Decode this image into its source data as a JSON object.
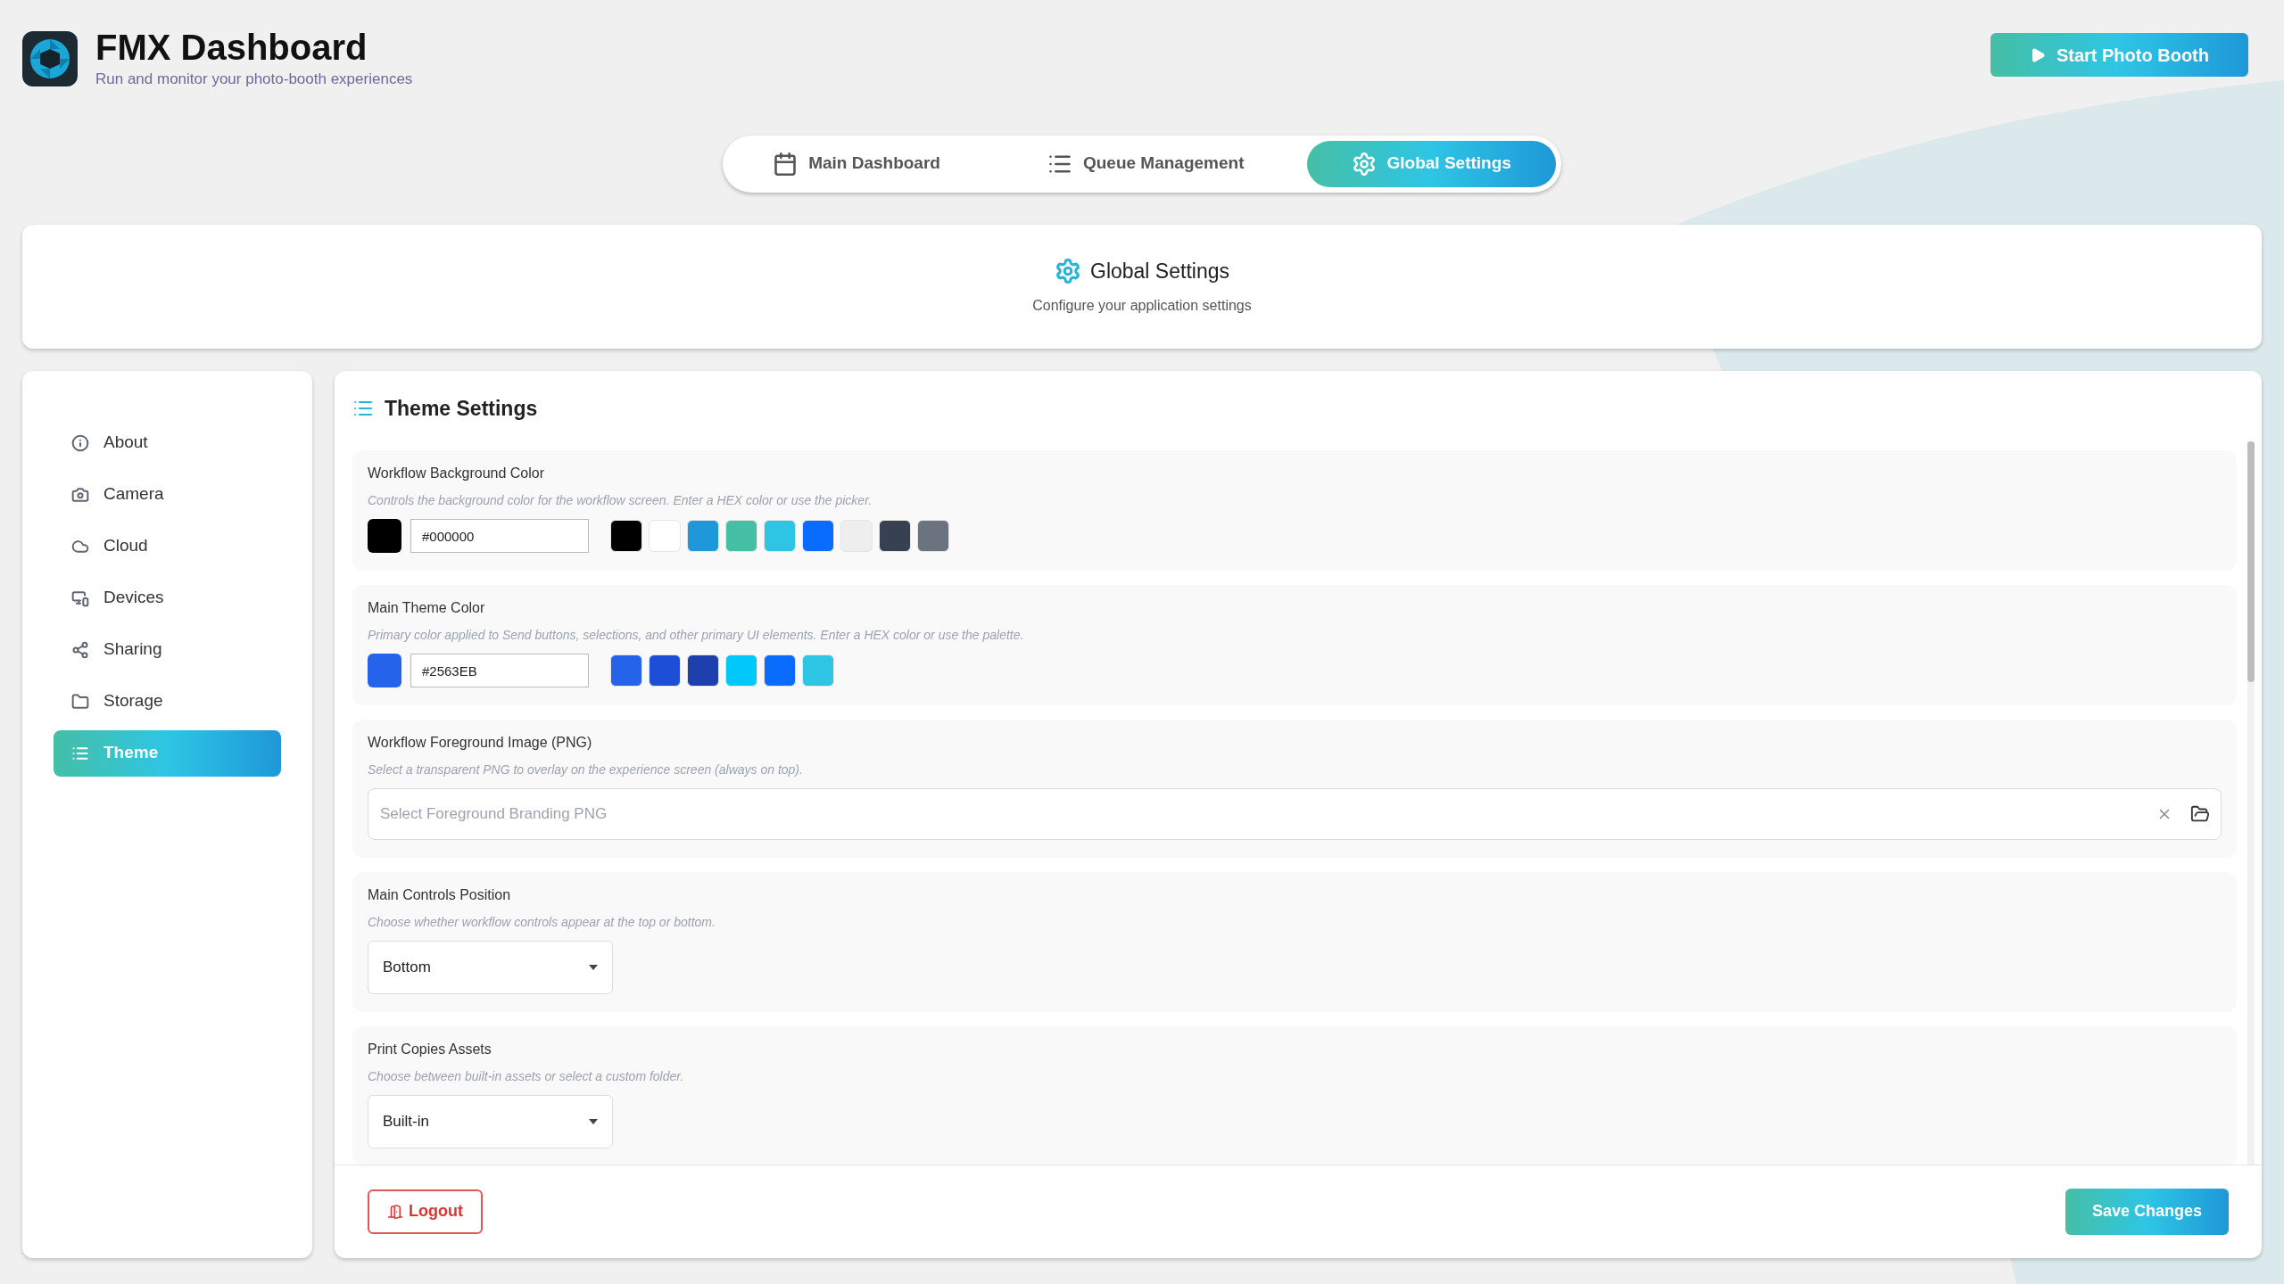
{
  "header": {
    "title": "FMX Dashboard",
    "subtitle": "Run and monitor your photo-booth experiences",
    "start_button": "Start Photo Booth"
  },
  "tabs": [
    {
      "label": "Main Dashboard",
      "selected": false
    },
    {
      "label": "Queue Management",
      "selected": false
    },
    {
      "label": "Global Settings",
      "selected": true
    }
  ],
  "page_header": {
    "title": "Global Settings",
    "subtitle": "Configure your application settings"
  },
  "sidebar": {
    "items": [
      {
        "label": "About",
        "selected": false
      },
      {
        "label": "Camera",
        "selected": false
      },
      {
        "label": "Cloud",
        "selected": false
      },
      {
        "label": "Devices",
        "selected": false
      },
      {
        "label": "Sharing",
        "selected": false
      },
      {
        "label": "Storage",
        "selected": false
      },
      {
        "label": "Theme",
        "selected": true
      }
    ]
  },
  "theme": {
    "title": "Theme Settings",
    "sections": [
      {
        "kind": "color",
        "label": "Workflow Background Color",
        "description": "Controls the background color for the workflow screen. Enter a HEX color or use the picker.",
        "value": "#000000",
        "color": "#000000",
        "swatches": [
          {
            "color": "#000000"
          },
          {
            "color": "#ffffff"
          },
          {
            "color": "#1e98d8"
          },
          {
            "color": "#45bfa6"
          },
          {
            "color": "#2ec5e5"
          },
          {
            "color": "#0a6cff"
          },
          {
            "color": "#eeeeee"
          },
          {
            "color": "#374151"
          },
          {
            "color": "#6b7280"
          }
        ]
      },
      {
        "kind": "color",
        "label": "Main Theme Color",
        "description": "Primary color applied to Send buttons, selections, and other primary UI elements. Enter a HEX color or use the palette.",
        "value": "#2563EB",
        "color": "#2563eb",
        "swatches": [
          {
            "color": "#2563eb"
          },
          {
            "color": "#1d4ed8"
          },
          {
            "color": "#1e40af"
          },
          {
            "color": "#00c8fa"
          },
          {
            "color": "#0a6cff"
          },
          {
            "color": "#2ec5e5"
          }
        ]
      },
      {
        "kind": "file",
        "label": "Workflow Foreground Image (PNG)",
        "description": "Select a transparent PNG to overlay on the experience screen (always on top).",
        "placeholder": "Select Foreground Branding PNG"
      },
      {
        "kind": "select",
        "label": "Main Controls Position",
        "description": "Choose whether workflow controls appear at the top or bottom.",
        "value": "Bottom"
      },
      {
        "kind": "select",
        "label": "Print Copies Assets",
        "description": "Choose between built-in assets or select a custom folder.",
        "value": "Built-in"
      }
    ]
  },
  "footer": {
    "logout": "Logout",
    "save": "Save Changes"
  }
}
